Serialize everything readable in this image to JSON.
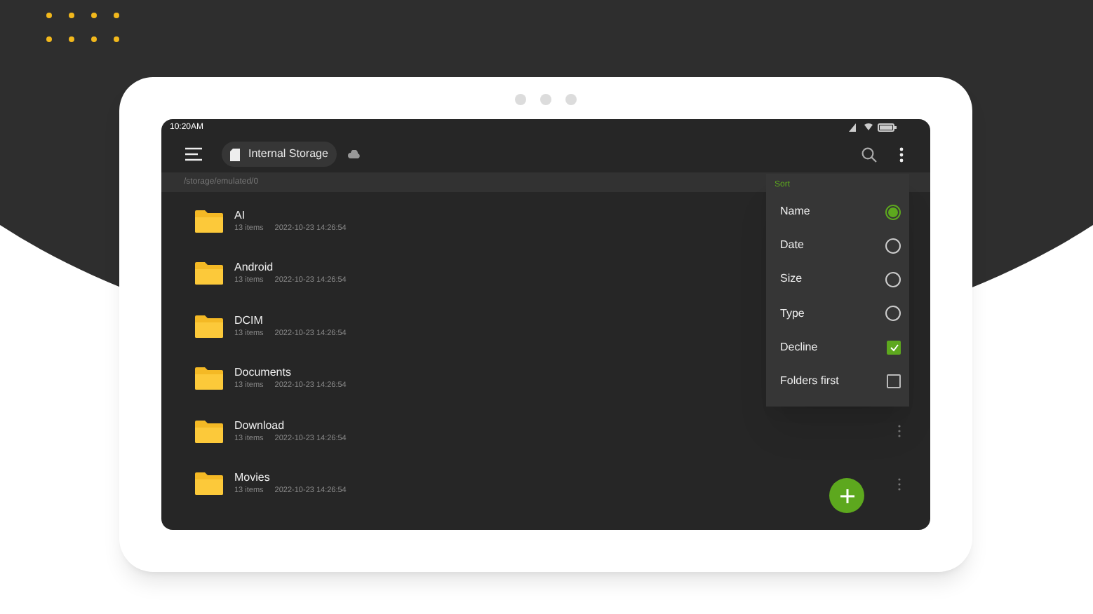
{
  "status_bar": {
    "time": "10:20AM"
  },
  "toolbar": {
    "location": "Internal Storage"
  },
  "path": "/storage/emulated/0",
  "files": [
    {
      "name": "AI",
      "count": "13 items",
      "modified": "2022-10-23 14:26:54"
    },
    {
      "name": "Android",
      "count": "13 items",
      "modified": "2022-10-23 14:26:54"
    },
    {
      "name": "DCIM",
      "count": "13 items",
      "modified": "2022-10-23 14:26:54"
    },
    {
      "name": "Documents",
      "count": "13 items",
      "modified": "2022-10-23 14:26:54"
    },
    {
      "name": "Download",
      "count": "13 items",
      "modified": "2022-10-23 14:26:54"
    },
    {
      "name": "Movies",
      "count": "13 items",
      "modified": "2022-10-23 14:26:54"
    }
  ],
  "sort_menu": {
    "title": "Sort",
    "options": [
      {
        "label": "Name",
        "kind": "radio",
        "selected": true
      },
      {
        "label": "Date",
        "kind": "radio",
        "selected": false
      },
      {
        "label": "Size",
        "kind": "radio",
        "selected": false
      },
      {
        "label": "Type",
        "kind": "radio",
        "selected": false
      },
      {
        "label": "Decline",
        "kind": "checkbox",
        "checked": true
      },
      {
        "label": "Folders first",
        "kind": "checkbox",
        "checked": false
      }
    ]
  }
}
